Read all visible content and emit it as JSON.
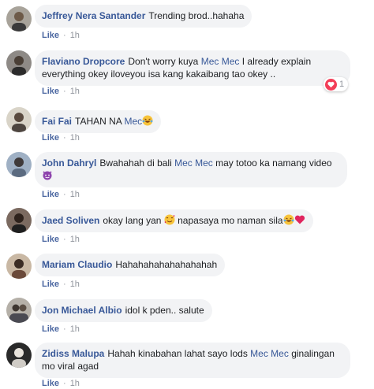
{
  "comments": [
    {
      "author": "Jeffrey Nera Santander",
      "text": "Trending brod..hahaha",
      "like": "Like",
      "time": "1h",
      "avatar": "person-avatar"
    },
    {
      "author": "Flaviano Dropcore",
      "text1": "Don't worry kuya",
      "mention": "Mec Mec",
      "text2": "I already explain",
      "line2": "everything okey iloveyou isa kang kakaibang tao okey ..",
      "like": "Like",
      "time": "1h",
      "reaction_count": "1",
      "avatar": "person-avatar"
    },
    {
      "author": "Fai Fai",
      "text": "TAHAN NA",
      "mention": "Mec",
      "like": "Like",
      "time": "1h",
      "emoji": "laughing-tears-emoji",
      "avatar": "person-avatar"
    },
    {
      "author": "John Dahryl",
      "text1": "Bwahahah di bali",
      "mention": "Mec Mec",
      "text2": "may totoo ka namang video",
      "like": "Like",
      "time": "1h",
      "emoji": "purple-devil-emoji",
      "avatar": "person-avatar"
    },
    {
      "author": "Jaed Soliven",
      "text1": "okay lang yan",
      "text2": "napasaya mo naman sila",
      "like": "Like",
      "time": "1h",
      "emoji": [
        "smiling-hearts-emoji",
        "laughing-tears-emoji",
        "red-heart-emoji"
      ],
      "avatar": "person-avatar"
    },
    {
      "author": "Mariam Claudio",
      "text": "Hahahahahahahahahah",
      "like": "Like",
      "time": "1h",
      "avatar": "person-avatar"
    },
    {
      "author": "Jon Michael Albio",
      "text": "idol k pden.. salute",
      "like": "Like",
      "time": "1h",
      "avatar": "person-avatar"
    },
    {
      "author": "Zidiss Malupa",
      "text1": "Hahah kinabahan lahat sayo lods",
      "mention": "Mec Mec",
      "text2": "ginalingan",
      "line2": "mo viral agad",
      "like": "Like",
      "time": "1h",
      "avatar": "person-avatar"
    }
  ],
  "separator": "·",
  "colors": {
    "author": "#385898",
    "bubble": "#f2f3f5",
    "meta": "#90949c",
    "heart": "#f33e58"
  }
}
